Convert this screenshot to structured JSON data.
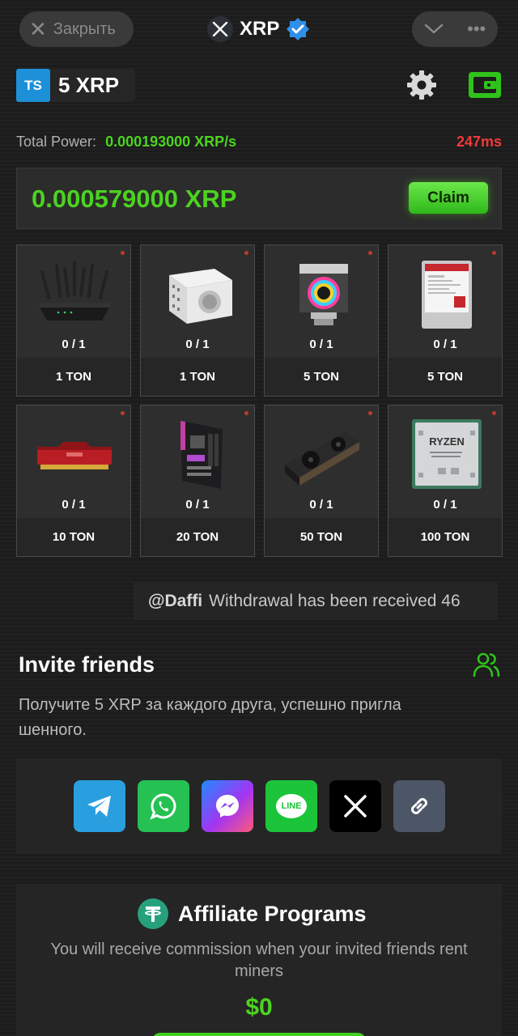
{
  "topbar": {
    "close_label": "Закрыть",
    "title": "XRP",
    "more_glyph": "•••"
  },
  "balance": {
    "badge": "TS",
    "amount": "5 XRP"
  },
  "power": {
    "label": "Total Power:",
    "value": "0.000193000 XRP/s",
    "ping": "247ms"
  },
  "claim": {
    "mined": "0.000579000 XRP",
    "button": "Claim"
  },
  "miners": [
    {
      "count": "0 / 1",
      "price": "1 TON",
      "icon": "router-icon"
    },
    {
      "count": "0 / 1",
      "price": "1 TON",
      "icon": "power-supply-icon"
    },
    {
      "count": "0 / 1",
      "price": "5 TON",
      "icon": "cpu-cooler-icon"
    },
    {
      "count": "0 / 1",
      "price": "5 TON",
      "icon": "hard-drive-icon"
    },
    {
      "count": "0 / 1",
      "price": "10 TON",
      "icon": "ram-icon"
    },
    {
      "count": "0 / 1",
      "price": "20 TON",
      "icon": "motherboard-icon"
    },
    {
      "count": "0 / 1",
      "price": "50 TON",
      "icon": "gpu-icon"
    },
    {
      "count": "0 / 1",
      "price": "100 TON",
      "icon": "cpu-icon",
      "cpu_label": "RYZEN"
    }
  ],
  "ticker": {
    "user": "@Daffi",
    "message": "Withdrawal has been received 46"
  },
  "invite": {
    "title": "Invite friends",
    "description": "Получите 5 XRP за каждого друга, успешно приглашенного."
  },
  "share": {
    "line_label": "LINE"
  },
  "affiliate": {
    "title": "Affiliate Programs",
    "description": "You will receive commission when your invited friends rent miners",
    "amount": "$0"
  },
  "colors": {
    "accent_green": "#4cd31f",
    "ping_red": "#f03a3a",
    "telegram": "#2a9fe0",
    "whatsapp": "#25c152",
    "line": "#1cc43a",
    "x": "#000000",
    "link": "#4d5666"
  }
}
